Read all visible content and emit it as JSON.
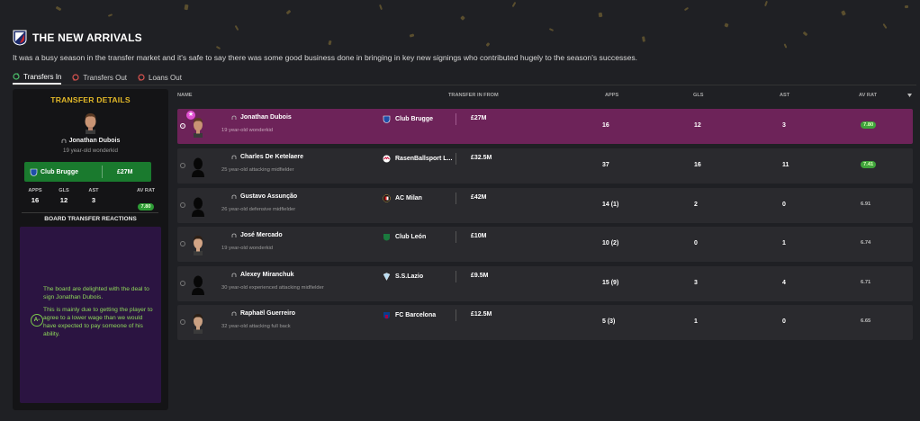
{
  "header": {
    "title": "THE NEW ARRIVALS",
    "subtitle": "It was a busy season in the transfer market and it's safe to say there was some good business done in bringing in key new signings who contributed hugely to the season's successes."
  },
  "tabs": [
    {
      "label": "Transfers In",
      "active": true,
      "icon": "transfer-in-icon",
      "color": "#4bbf6a"
    },
    {
      "label": "Transfers Out",
      "active": false,
      "icon": "transfer-out-icon",
      "color": "#d9534f"
    },
    {
      "label": "Loans Out",
      "active": false,
      "icon": "loan-out-icon",
      "color": "#d9534f"
    }
  ],
  "details": {
    "title": "TRANSFER DETAILS",
    "name": "Jonathan Dubois",
    "desc": "19 year-old wonderkid",
    "club": "Club Brugge",
    "fee": "£27M",
    "stats": {
      "apps_label": "APPS",
      "apps": "16",
      "gls_label": "GLS",
      "gls": "12",
      "ast_label": "AST",
      "ast": "3",
      "avrat_label": "AV RAT",
      "avrat": "7.80"
    },
    "board_title": "BOARD TRANSFER REACTIONS",
    "grade": "A-",
    "reaction_1": "The board are delighted with the deal to sign Jonathan Dubois.",
    "reaction_2": "This is mainly due to getting the player to agree to a lower wage than we would have expected to pay someone of his ability."
  },
  "table": {
    "headers": {
      "name": "NAME",
      "from": "TRANSFER IN FROM",
      "apps": "APPS",
      "gls": "GLS",
      "ast": "AST",
      "avrat": "AV RAT"
    },
    "rows": [
      {
        "name": "Jonathan Dubois",
        "desc": "19 year-old wonderkid",
        "club": "Club Brugge",
        "fee": "£27M",
        "apps": "16",
        "gls": "12",
        "ast": "3",
        "avrat": "7.80",
        "selected": true
      },
      {
        "name": "Charles De Ketelaere",
        "desc": "25 year-old attacking midfielder",
        "club": "RasenBallsport L...",
        "fee": "£32.5M",
        "apps": "37",
        "gls": "16",
        "ast": "11",
        "avrat": "7.41"
      },
      {
        "name": "Gustavo Assunção",
        "desc": "26 year-old defensive midfielder",
        "club": "AC Milan",
        "fee": "£42M",
        "apps": "14 (1)",
        "gls": "2",
        "ast": "0",
        "avrat": "6.91"
      },
      {
        "name": "José Mercado",
        "desc": "19 year-old wonderkid",
        "club": "Club León",
        "fee": "£10M",
        "apps": "10 (2)",
        "gls": "0",
        "ast": "1",
        "avrat": "6.74"
      },
      {
        "name": "Alexey Miranchuk",
        "desc": "30 year-old experienced attacking midfielder",
        "club": "S.S.Lazio",
        "fee": "£9.5M",
        "apps": "15 (9)",
        "gls": "3",
        "ast": "4",
        "avrat": "6.71"
      },
      {
        "name": "Raphaël Guerreiro",
        "desc": "32 year-old attacking full back",
        "club": "FC Barcelona",
        "fee": "£12.5M",
        "apps": "5 (3)",
        "gls": "1",
        "ast": "0",
        "avrat": "6.65"
      }
    ]
  },
  "colors": {
    "accent_gold": "#e3b928",
    "selected_row": "#6d2359",
    "board_bg": "#2b1441",
    "rating_green": "#3fa33b"
  }
}
